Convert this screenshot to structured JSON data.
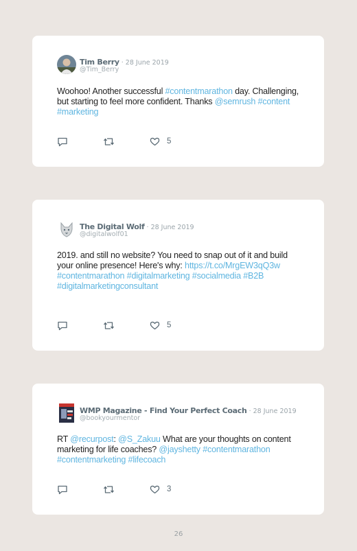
{
  "tweets": [
    {
      "name": "Tim Berry",
      "sep": " · ",
      "date": "28 June 2019",
      "handle": "@Tim_Berry",
      "text": [
        {
          "t": "Woohoo! Another successful ",
          "link": false
        },
        {
          "t": "#contentmarathon",
          "link": true
        },
        {
          "t": " day. Challenging, but starting to feel more confident. Thanks ",
          "link": false
        },
        {
          "t": "@semrush",
          "link": true
        },
        {
          "t": " ",
          "link": false
        },
        {
          "t": "#content",
          "link": true
        },
        {
          "t": " ",
          "link": false
        },
        {
          "t": "#marketing",
          "link": true
        }
      ],
      "likes": "5",
      "avatar": "person-photo"
    },
    {
      "name": "The Digital Wolf",
      "sep": " · ",
      "date": "28 June 2019",
      "handle": "@digitalwolf01",
      "text": [
        {
          "t": "2019. and still no website? You need to snap out of it and build your online presence! Here's why: ",
          "link": false
        },
        {
          "t": "https://t.co/MrgEW3qQ3w",
          "link": true
        },
        {
          "t": " ",
          "link": false
        },
        {
          "t": "#contentmarathon",
          "link": true
        },
        {
          "t": " ",
          "link": false
        },
        {
          "t": "#digitalmarketing",
          "link": true
        },
        {
          "t": " ",
          "link": false
        },
        {
          "t": "#socialmedia",
          "link": true
        },
        {
          "t": " ",
          "link": false
        },
        {
          "t": "#B2B",
          "link": true
        },
        {
          "t": " ",
          "link": false
        },
        {
          "t": "#digitalmarketingconsultant",
          "link": true
        }
      ],
      "likes": "5",
      "avatar": "wolf-logo"
    },
    {
      "name": "WMP Magazine - Find Your Perfect Coach",
      "sep": " · ",
      "date": "28 June 2019",
      "handle": "@bookyourmentor",
      "text": [
        {
          "t": "RT ",
          "link": false
        },
        {
          "t": "@recurpost",
          "link": true
        },
        {
          "t": ": ",
          "link": false
        },
        {
          "t": "@S_Zakuu",
          "link": true
        },
        {
          "t": " What are your thoughts on content marketing for life coaches? ",
          "link": false
        },
        {
          "t": "@jayshetty",
          "link": true
        },
        {
          "t": " ",
          "link": false
        },
        {
          "t": "#contentmarathon",
          "link": true
        },
        {
          "t": " ",
          "link": false
        },
        {
          "t": "#contentmarketing",
          "link": true
        },
        {
          "t": " ",
          "link": false
        },
        {
          "t": "#lifecoach",
          "link": true
        }
      ],
      "likes": "3",
      "avatar": "magazine-cover"
    }
  ],
  "page_number": "26",
  "colors": {
    "link": "#5fb5e0",
    "name": "#5b6b75",
    "background": "#ebe6e2"
  },
  "icons": [
    "reply-icon",
    "retweet-icon",
    "like-icon"
  ]
}
